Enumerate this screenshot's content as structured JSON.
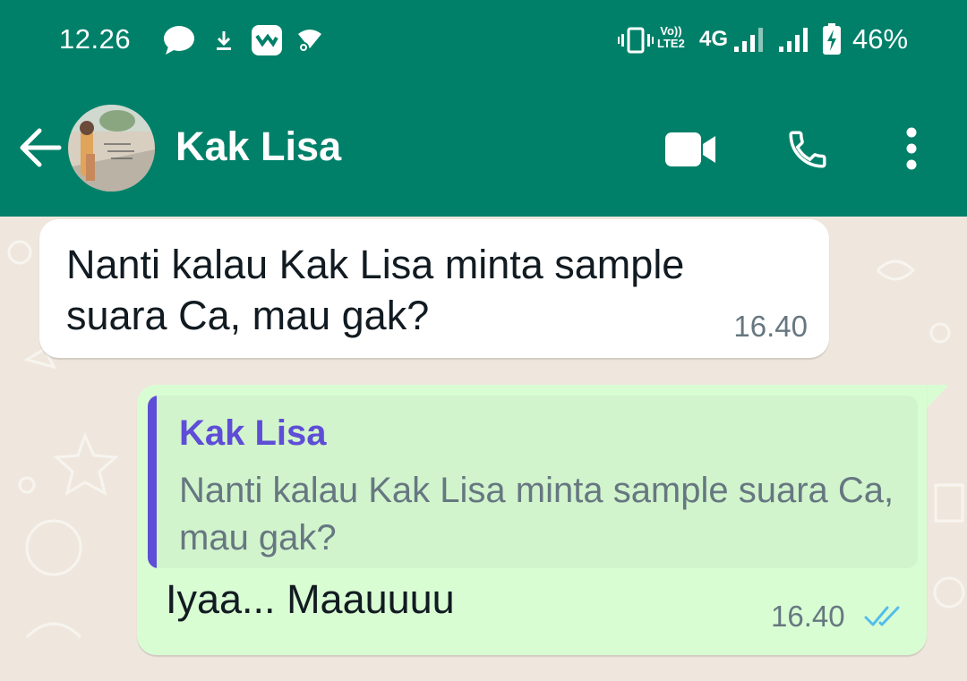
{
  "status_bar": {
    "time": "12.26",
    "volte_line1": "Vo))",
    "volte_line2": "LTE2",
    "network": "4G",
    "battery": "46%",
    "icons": [
      "chat-notification-icon",
      "download-icon",
      "app-notification-icon",
      "wifi-key-icon",
      "vibrate-icon",
      "signal-icon",
      "signal-icon",
      "battery-charging-icon"
    ]
  },
  "header": {
    "contact_name": "Kak Lisa",
    "actions": [
      "video-call-icon",
      "voice-call-icon",
      "more-options-icon"
    ]
  },
  "messages": [
    {
      "direction": "incoming",
      "text": "Nanti kalau Kak Lisa minta sample suara Ca, mau gak?",
      "time": "16.40"
    },
    {
      "direction": "outgoing",
      "quote": {
        "author": "Kak Lisa",
        "text": "Nanti kalau Kak Lisa minta sample suara Ca, mau gak?"
      },
      "text": "Iyaa... Maauuuu",
      "time": "16.40",
      "status": "read"
    }
  ],
  "colors": {
    "header": "#008069",
    "chat_background": "#efe7dd",
    "incoming_bubble": "#ffffff",
    "outgoing_bubble": "#d9fdd3",
    "quote_accent": "#5e4dd6",
    "read_ticks": "#53bdeb"
  }
}
